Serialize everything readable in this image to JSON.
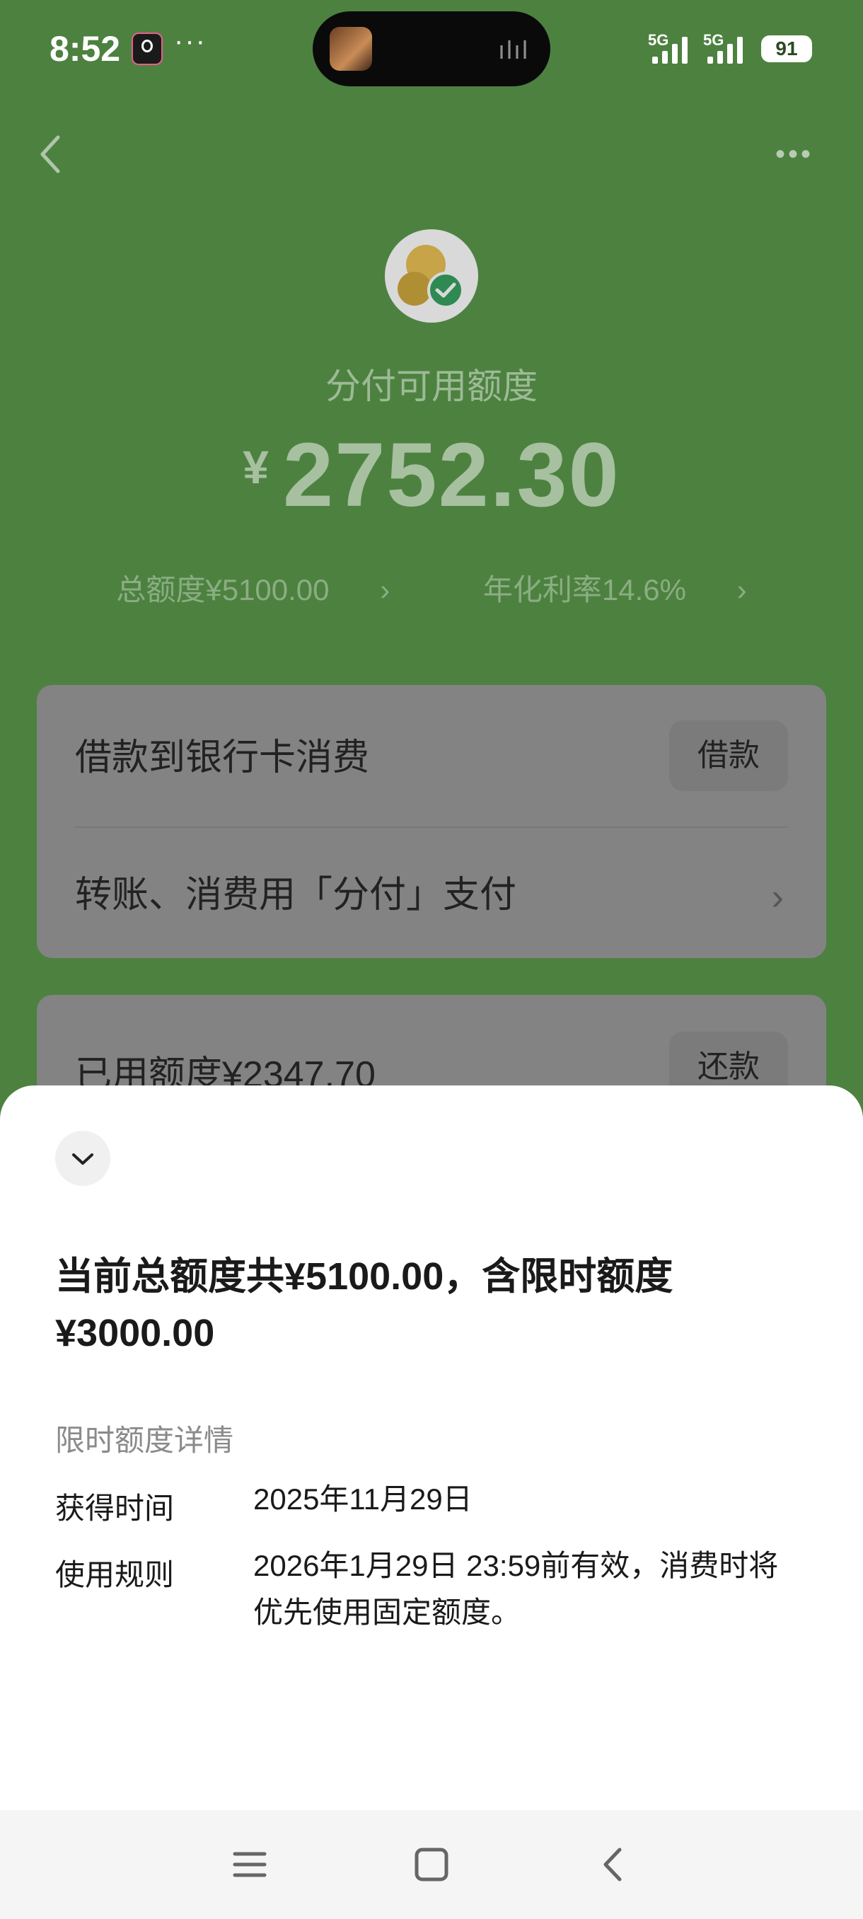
{
  "status_bar": {
    "time": "8:52",
    "signal1": "5G",
    "signal2": "5G",
    "battery": "91"
  },
  "header": {
    "back_icon": "chevron-left-icon",
    "more_icon": "more-horizontal-icon"
  },
  "summary": {
    "label": "分付可用额度",
    "currency": "¥",
    "amount": "2752.30",
    "total_limit": "总额度¥5100.00",
    "annual_rate": "年化利率14.6%"
  },
  "card1": {
    "borrow_text": "借款到银行卡消费",
    "borrow_button": "借款",
    "pay_text": "转账、消费用「分付」支付"
  },
  "card2": {
    "used_text": "已用额度¥2347.70",
    "repay_button": "还款"
  },
  "sheet": {
    "title": "当前总额度共¥5100.00，含限时额度¥3000.00",
    "section_label": "限时额度详情",
    "obtain_key": "获得时间",
    "obtain_value": "2025年11月29日",
    "rule_key": "使用规则",
    "rule_value": "2026年1月29日 23:59前有效，消费时将优先使用固定额度。"
  },
  "colors": {
    "background": "#4d8140",
    "sheet": "#ffffff",
    "card": "#838383"
  }
}
